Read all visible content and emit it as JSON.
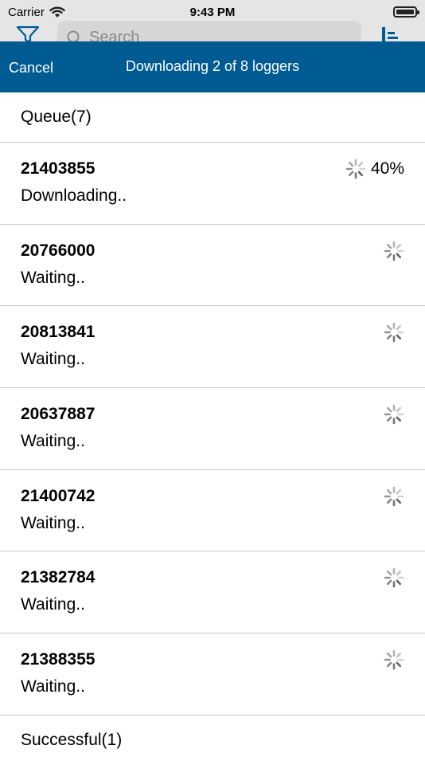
{
  "statusbar": {
    "carrier": "Carrier",
    "time": "9:43 PM"
  },
  "underlay": {
    "search_placeholder": "Search"
  },
  "navbar": {
    "cancel_label": "Cancel",
    "title": "Downloading 2 of 8 loggers"
  },
  "queue": {
    "header": "Queue(7)",
    "items": [
      {
        "id": "21403855",
        "status": "Downloading..",
        "progress": "40%"
      },
      {
        "id": "20766000",
        "status": "Waiting.."
      },
      {
        "id": "20813841",
        "status": "Waiting.."
      },
      {
        "id": "20637887",
        "status": "Waiting.."
      },
      {
        "id": "21400742",
        "status": "Waiting.."
      },
      {
        "id": "21382784",
        "status": "Waiting.."
      },
      {
        "id": "21388355",
        "status": "Waiting.."
      }
    ]
  },
  "successful": {
    "header": "Successful(1)"
  },
  "colors": {
    "nav_background": "#005b92",
    "separator": "#c8c8cc"
  },
  "icons": {
    "status_wifi": "wifi-icon",
    "status_battery": "battery-icon",
    "row_activity": "spinner-icon"
  }
}
